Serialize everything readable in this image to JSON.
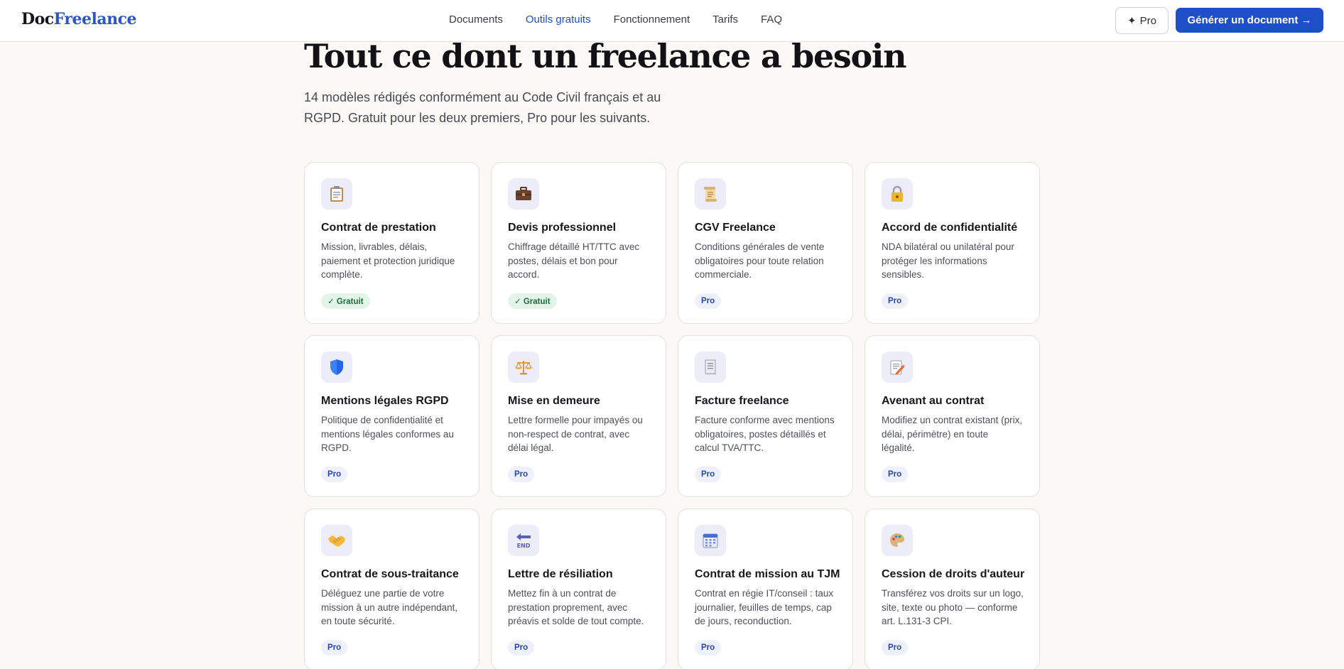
{
  "header": {
    "logo_part1": "Doc",
    "logo_part2": "Freelance",
    "nav": [
      {
        "label": "Documents",
        "active": false
      },
      {
        "label": "Outils gratuits",
        "active": true
      },
      {
        "label": "Fonctionnement",
        "active": false
      },
      {
        "label": "Tarifs",
        "active": false
      },
      {
        "label": "FAQ",
        "active": false
      }
    ],
    "pro_button_icon": "✦",
    "pro_button_label": "Pro",
    "cta_label": "Générer un document →"
  },
  "hero": {
    "title": "Tout ce dont un freelance a besoin",
    "subtitle": "14 modèles rédigés conformément au Code Civil français et au RGPD. Gratuit pour les deux premiers, Pro pour les suivants."
  },
  "cards": [
    {
      "icon": "clipboard-icon",
      "title": "Contrat de prestation",
      "desc": "Mission, livrables, délais, paiement et protection juridique complète.",
      "badge": "✓ Gratuit",
      "badge_type": "free"
    },
    {
      "icon": "briefcase-icon",
      "title": "Devis professionnel",
      "desc": "Chiffrage détaillé HT/TTC avec postes, délais et bon pour accord.",
      "badge": "✓ Gratuit",
      "badge_type": "free"
    },
    {
      "icon": "scroll-icon",
      "title": "CGV Freelance",
      "desc": "Conditions générales de vente obligatoires pour toute relation commerciale.",
      "badge": "Pro",
      "badge_type": "pro"
    },
    {
      "icon": "lock-icon",
      "title": "Accord de confidentialité",
      "desc": "NDA bilatéral ou unilatéral pour protéger les informations sensibles.",
      "badge": "Pro",
      "badge_type": "pro"
    },
    {
      "icon": "shield-icon",
      "title": "Mentions légales RGPD",
      "desc": "Politique de confidentialité et mentions légales conformes au RGPD.",
      "badge": "Pro",
      "badge_type": "pro"
    },
    {
      "icon": "balance-scale-icon",
      "title": "Mise en demeure",
      "desc": "Lettre formelle pour impayés ou non-respect de contrat, avec délai légal.",
      "badge": "Pro",
      "badge_type": "pro"
    },
    {
      "icon": "receipt-icon",
      "title": "Facture freelance",
      "desc": "Facture conforme avec mentions obligatoires, postes détaillés et calcul TVA/TTC.",
      "badge": "Pro",
      "badge_type": "pro"
    },
    {
      "icon": "memo-pencil-icon",
      "title": "Avenant au contrat",
      "desc": "Modifiez un contrat existant (prix, délai, périmètre) en toute légalité.",
      "badge": "Pro",
      "badge_type": "pro"
    },
    {
      "icon": "handshake-icon",
      "title": "Contrat de sous-traitance",
      "desc": "Déléguez une partie de votre mission à un autre indépendant, en toute sécurité.",
      "badge": "Pro",
      "badge_type": "pro"
    },
    {
      "icon": "end-arrow-icon",
      "title": "Lettre de résiliation",
      "desc": "Mettez fin à un contrat de prestation proprement, avec préavis et solde de tout compte.",
      "badge": "Pro",
      "badge_type": "pro"
    },
    {
      "icon": "calendar-icon",
      "title": "Contrat de mission au TJM",
      "desc": "Contrat en régie IT/conseil : taux journalier, feuilles de temps, cap de jours, reconduction.",
      "badge": "Pro",
      "badge_type": "pro"
    },
    {
      "icon": "palette-icon",
      "title": "Cession de droits d'auteur",
      "desc": "Transférez vos droits sur un logo, site, texte ou photo — conforme art. L.131-3 CPI.",
      "badge": "Pro",
      "badge_type": "pro"
    }
  ]
}
